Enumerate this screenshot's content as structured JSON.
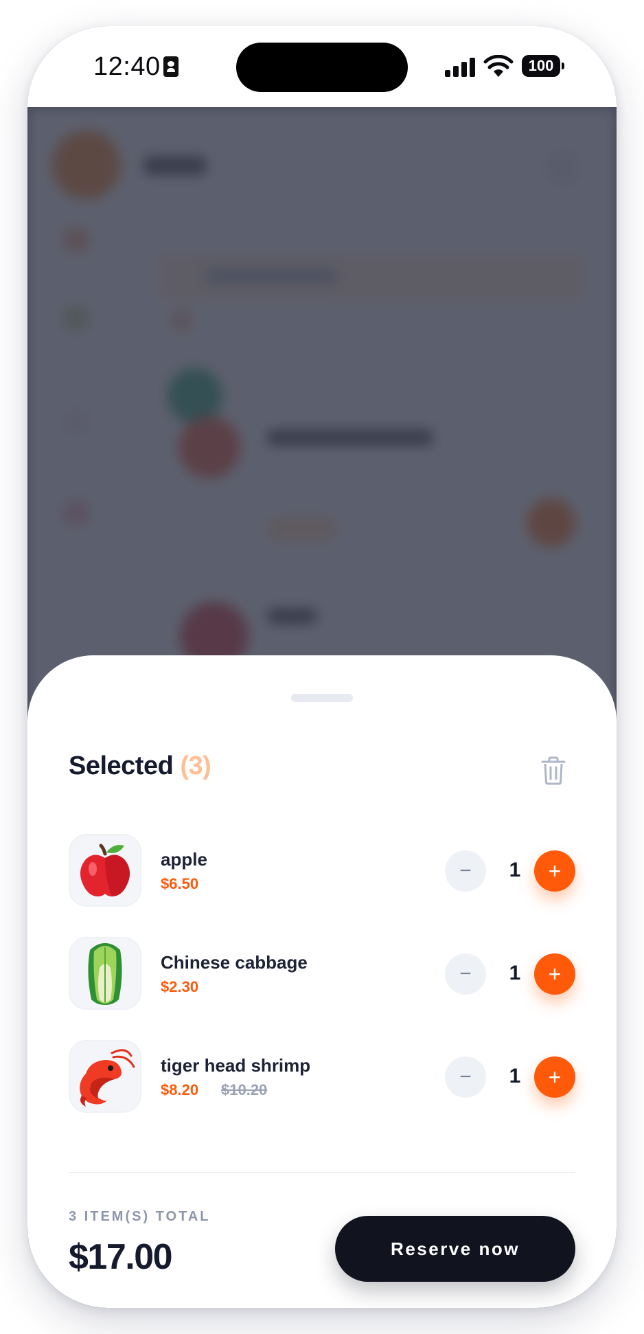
{
  "status_bar": {
    "time": "12:40",
    "battery": "100"
  },
  "cart": {
    "title": "Selected",
    "count_text": "(3)",
    "items": [
      {
        "name": "apple",
        "price": "$6.50",
        "old_price": "",
        "quantity": "1",
        "icon": "apple-icon"
      },
      {
        "name": "Chinese cabbage",
        "price": "$2.30",
        "old_price": "",
        "quantity": "1",
        "icon": "cabbage-icon"
      },
      {
        "name": "tiger head shrimp",
        "price": "$8.20",
        "old_price": "$10.20",
        "quantity": "1",
        "icon": "shrimp-icon"
      }
    ],
    "minus_symbol": "−",
    "plus_symbol": "+",
    "total_label": "3 ITEM(S) TOTAL",
    "total_value": "$17.00",
    "reserve_label": "Reserve now"
  },
  "colors": {
    "accent": "#ff5a0a",
    "count_accent": "#ffbf94",
    "dark": "#11131f",
    "overlay": "#5c6170"
  }
}
